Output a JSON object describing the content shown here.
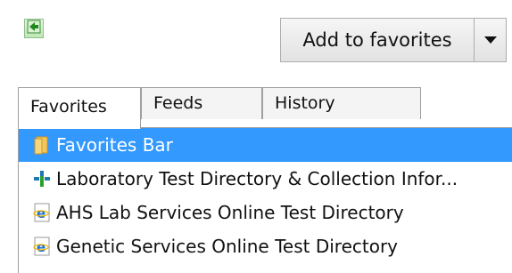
{
  "toolbar": {
    "pin_icon": "pin-green-arrow-icon",
    "add_to_favorites_label": "Add to favorites",
    "dropdown_icon": "chevron-down-icon"
  },
  "tabs": [
    {
      "label": "Favorites",
      "active": true
    },
    {
      "label": "Feeds",
      "active": false
    },
    {
      "label": "History",
      "active": false
    }
  ],
  "items": [
    {
      "label": "Favorites Bar",
      "icon": "folder-icon",
      "selected": true
    },
    {
      "label": "Laboratory Test Directory & Collection Infor...",
      "icon": "site-favicon-icon",
      "selected": false
    },
    {
      "label": "AHS Lab Services Online Test Directory",
      "icon": "ie-page-icon",
      "selected": false
    },
    {
      "label": "Genetic Services Online Test Directory",
      "icon": "ie-page-icon",
      "selected": false
    }
  ],
  "colors": {
    "selection": "#3399ff",
    "text": "#111111"
  }
}
